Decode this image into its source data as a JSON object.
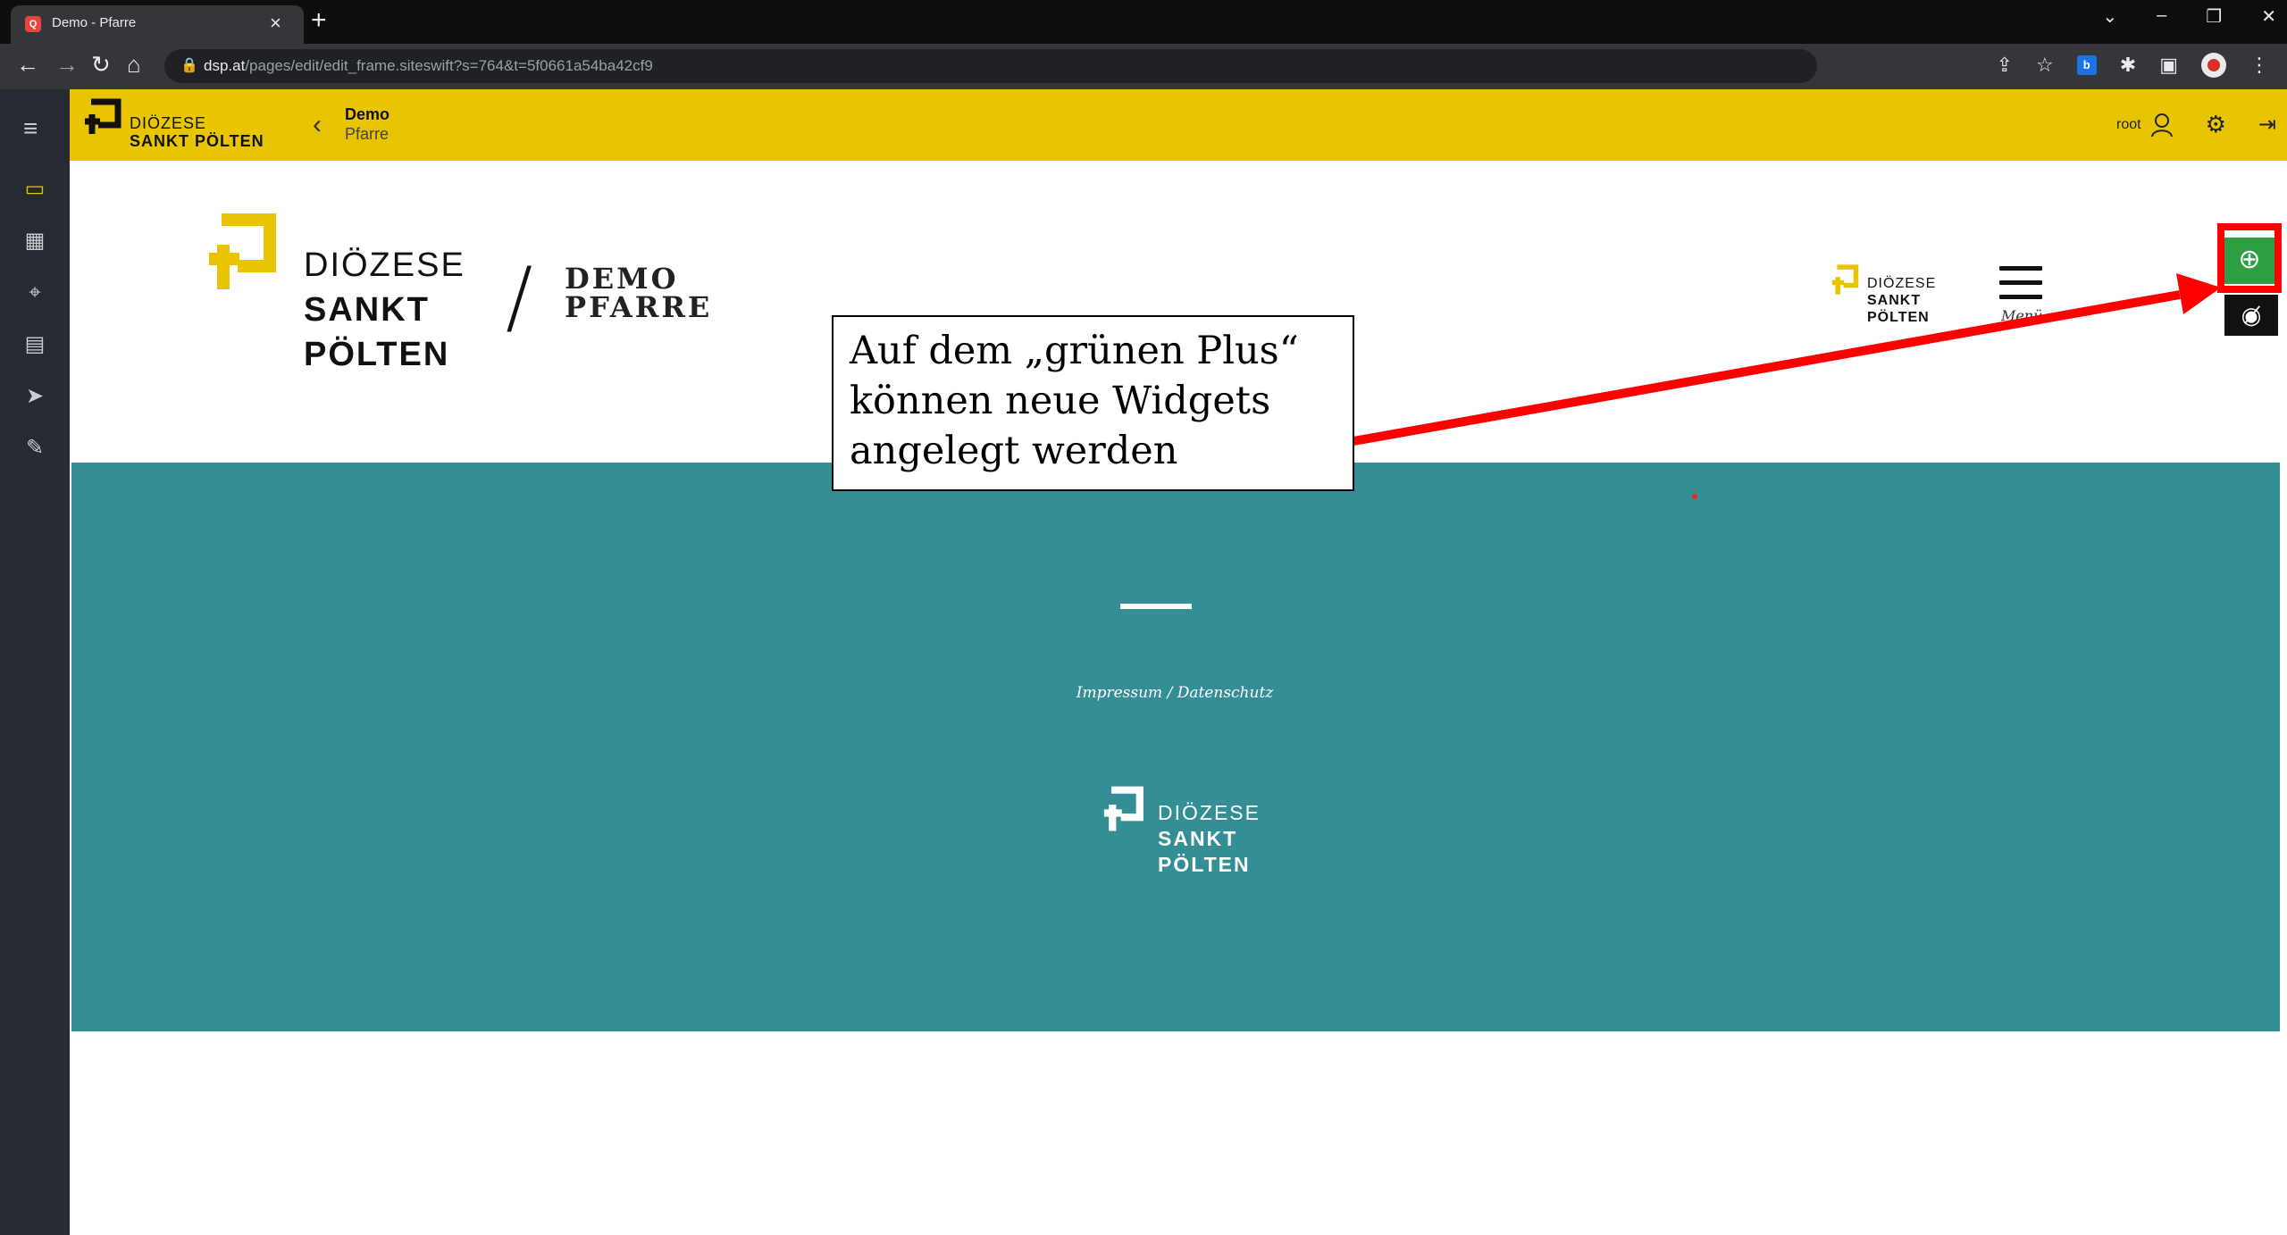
{
  "browser": {
    "tab_title": "Demo - Pfarre",
    "favicon_text": "Q",
    "new_tab": "+",
    "url_host": "dsp.at",
    "url_path": "/pages/edit/edit_frame.siteswift?s=764&t=5f0661a54ba42cf9"
  },
  "cms": {
    "logo_line1": "DIÖZESE",
    "logo_line2": "SANKT PÖLTEN",
    "breadcrumb_title": "Demo",
    "breadcrumb_sub": "Pfarre",
    "user_name": "root",
    "accent_color": "#e8c500",
    "sidebar_icons": [
      "menu-icon",
      "monitor-icon",
      "calendar-icon",
      "location-pin-icon",
      "contacts-icon",
      "send-icon",
      "edit-note-icon"
    ]
  },
  "page": {
    "logo_line1": "DIÖZESE",
    "logo_line2": "SANKT",
    "logo_line3": "PÖLTEN",
    "slash": "/",
    "site_line1": "DEMO",
    "site_line2": "PFARRE",
    "small_logo_line1": "DIÖZESE",
    "small_logo_line2": "SANKT",
    "small_logo_line3": "PÖLTEN",
    "menu_label": "Menü",
    "footer_link": "Impressum / Datenschutz",
    "footer_logo_line1": "DIÖZESE",
    "footer_logo_line2": "SANKT",
    "footer_logo_line3": "PÖLTEN",
    "teal_color": "#338e96",
    "plus_color": "#2ea043"
  },
  "annotation": {
    "line1": "Auf dem „grünen Plus“",
    "line2": "können neue Widgets",
    "line3": "angelegt werden",
    "color": "#ff0000"
  }
}
